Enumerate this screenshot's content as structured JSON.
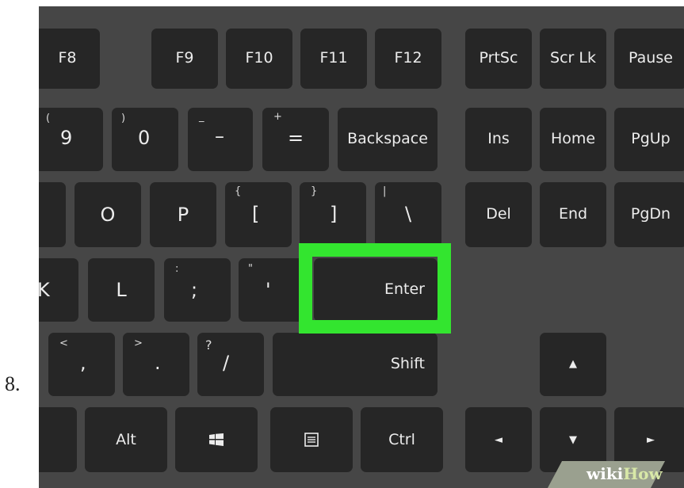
{
  "step": {
    "number": "8."
  },
  "keyboard": {
    "row1": {
      "f8": "F8",
      "f9": "F9",
      "f10": "F10",
      "f11": "F11",
      "f12": "F12",
      "prtsc": "PrtSc",
      "scrlk": "Scr Lk",
      "pause": "Pause"
    },
    "row2": {
      "paren_open": "(",
      "nine": "9",
      "paren_close": ")",
      "zero": "0",
      "underscore": "_",
      "minus": "–",
      "plus": "+",
      "equals": "=",
      "backspace": "Backspace",
      "ins": "Ins",
      "home": "Home",
      "pgup": "PgUp"
    },
    "row3": {
      "o": "O",
      "p": "P",
      "brace_open": "{",
      "bracket_open": "[",
      "brace_close": "}",
      "bracket_close": "]",
      "pipe": "|",
      "backslash": "\\",
      "del": "Del",
      "end": "End",
      "pgdn": "PgDn"
    },
    "row4": {
      "k": "K",
      "l": "L",
      "colon": ":",
      "semicolon": ";",
      "quote": "\"",
      "apostrophe": "'",
      "enter": "Enter"
    },
    "row5": {
      "lt": "<",
      "comma": ",",
      "gt": ">",
      "period": ".",
      "question": "?",
      "slash": "/",
      "shift": "Shift",
      "up_arrow": "▲"
    },
    "row6": {
      "alt": "Alt",
      "ctrl": "Ctrl",
      "left_arrow": "◄",
      "down_arrow": "▼",
      "right_arrow": "►"
    },
    "highlight_color": "#33e52f",
    "key_color": "#262626",
    "background_color": "#464646"
  },
  "watermark": {
    "brand_part1": "wiki",
    "brand_part2": "How"
  }
}
